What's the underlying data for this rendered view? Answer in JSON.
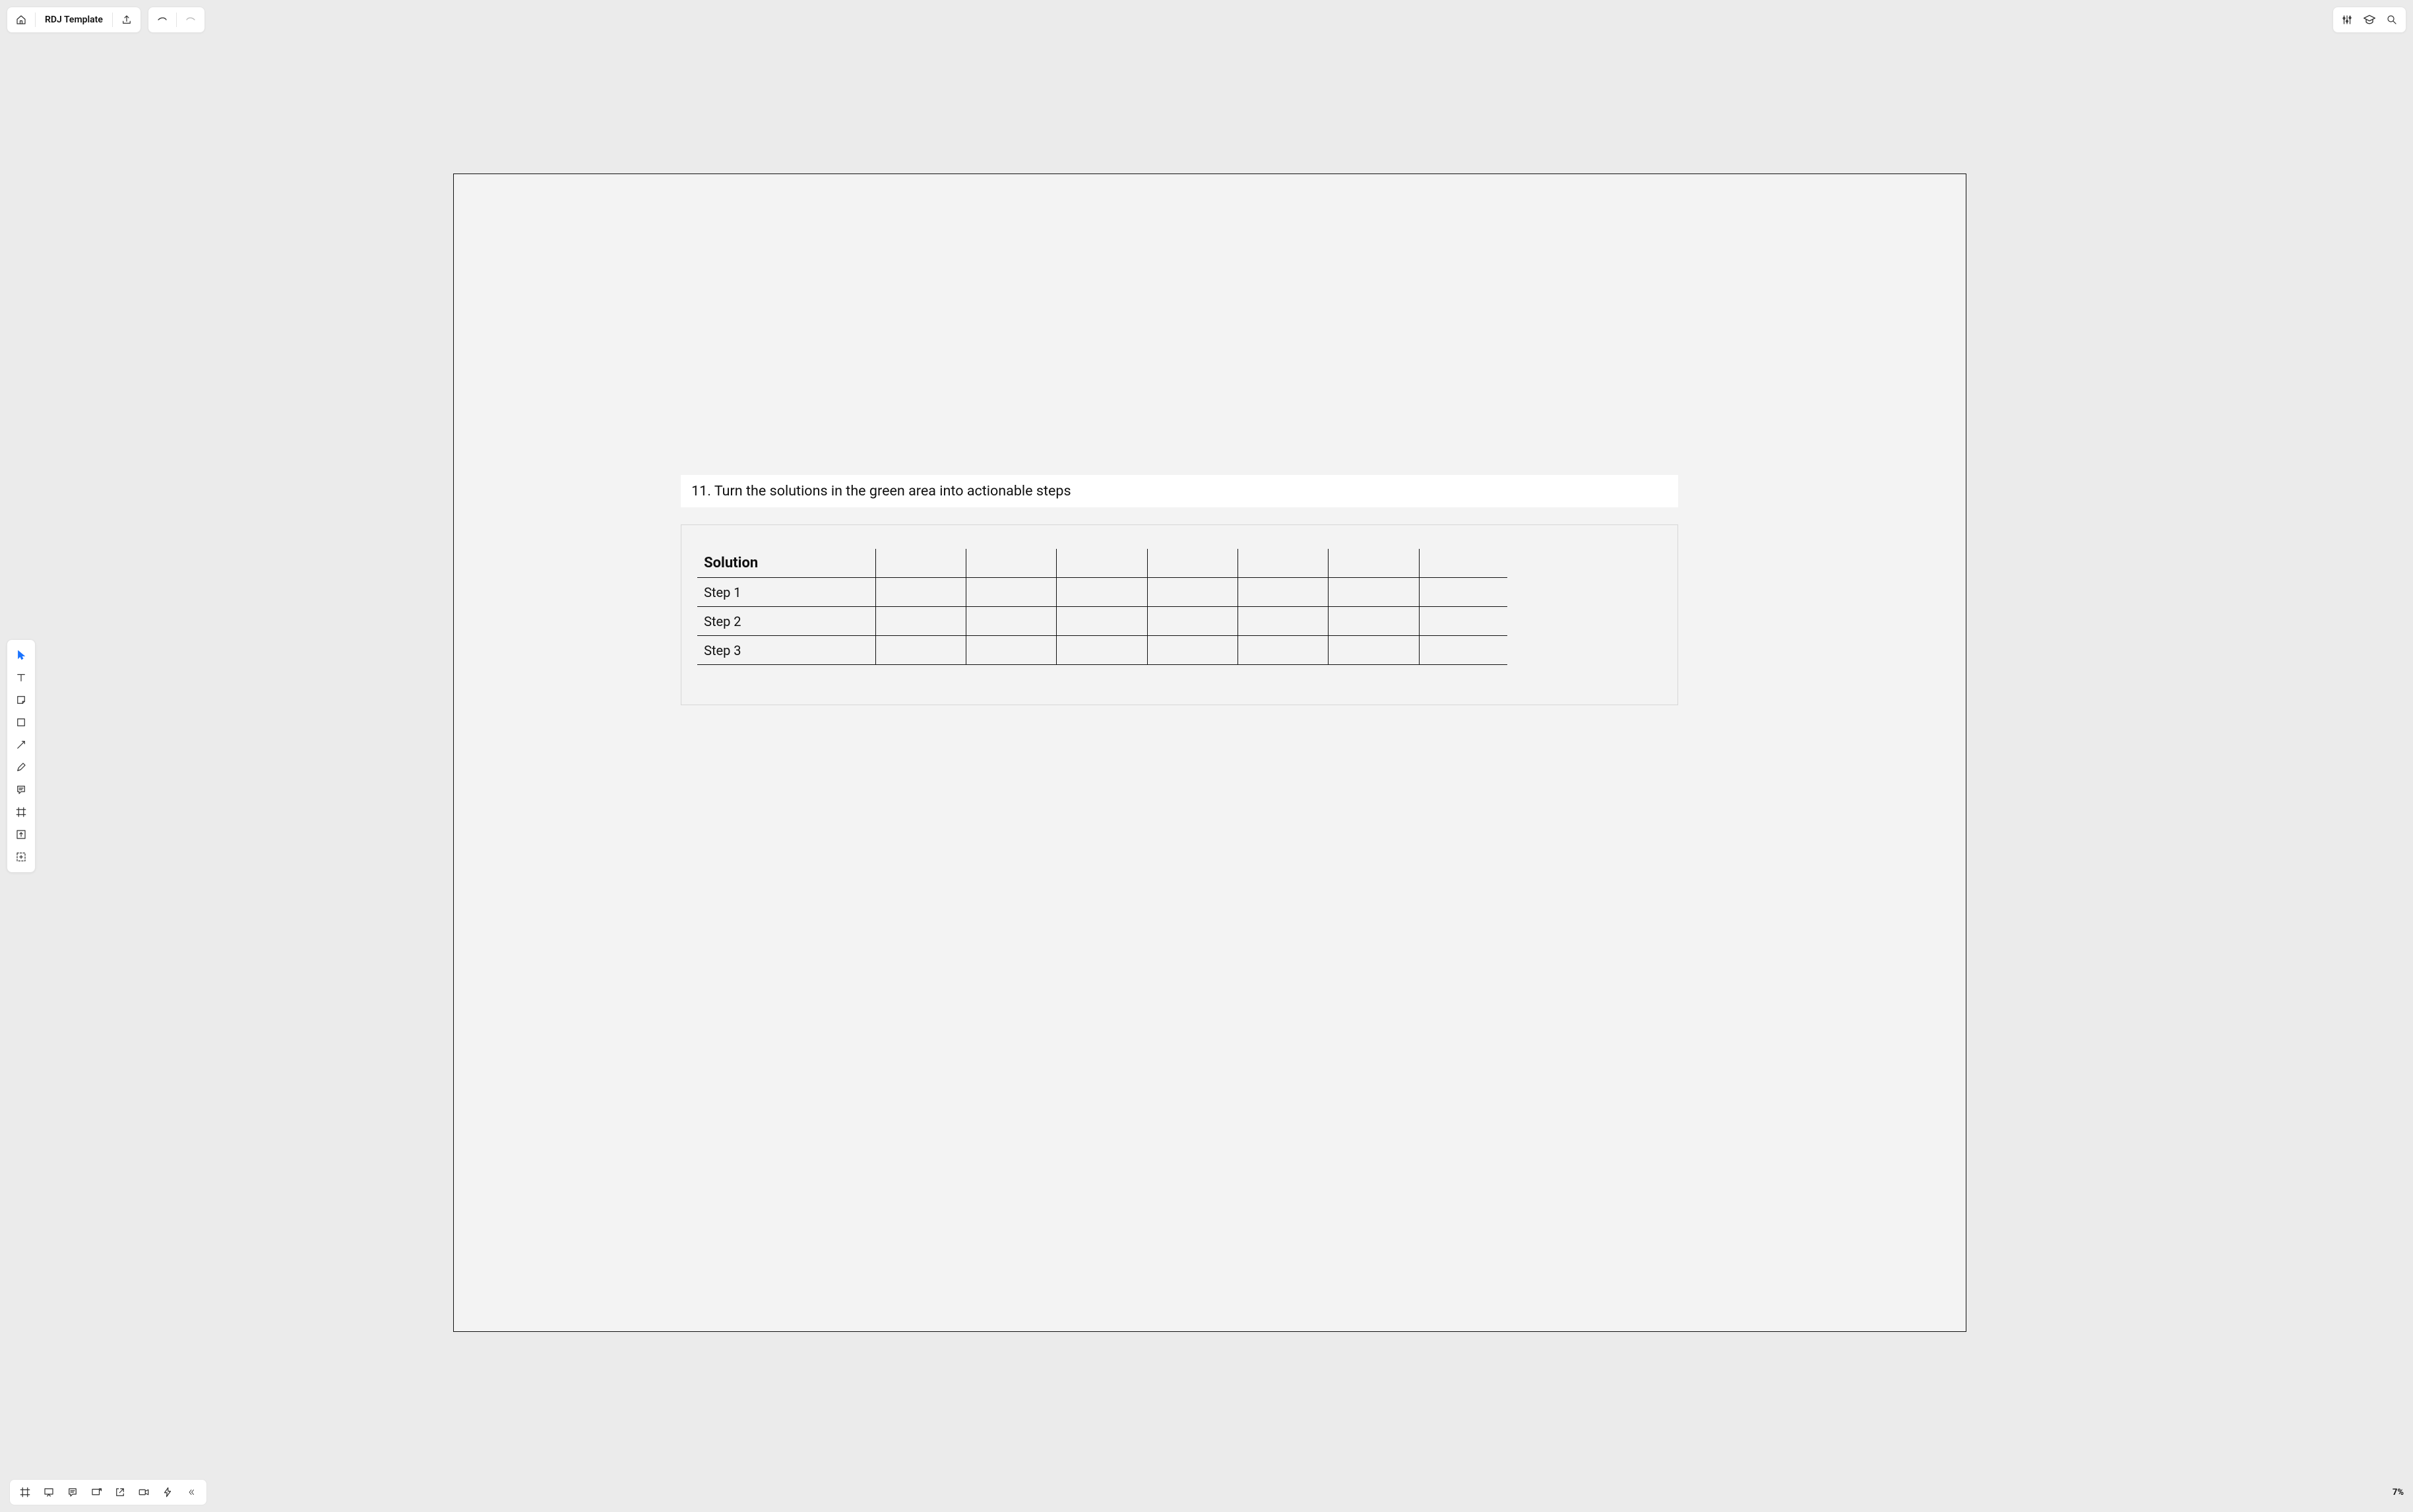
{
  "header": {
    "doc_title": "RDJ Template"
  },
  "zoom": "7%",
  "canvas": {
    "heading": "11. Turn the solutions in the green area into actionable steps",
    "table": {
      "header": "Solution",
      "rows": [
        "Step 1",
        "Step 2",
        "Step 3"
      ],
      "extra_cols": 7
    }
  }
}
